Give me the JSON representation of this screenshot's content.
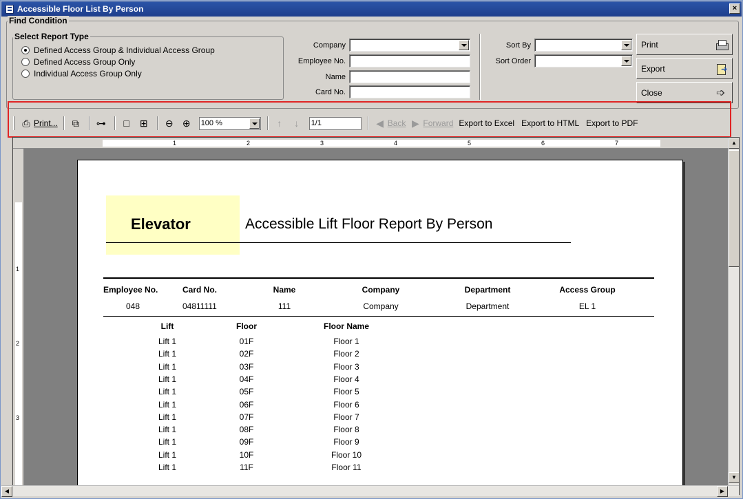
{
  "window": {
    "title": "Accessible Floor List By Person",
    "close_glyph": "×"
  },
  "find": {
    "legend": "Find Condition",
    "report_type_legend": "Select Report Type",
    "report_types": [
      {
        "label": "Defined Access Group & Individual Access Group",
        "checked": true
      },
      {
        "label": "Defined Access Group Only",
        "checked": false
      },
      {
        "label": "Individual Access Group Only",
        "checked": false
      }
    ],
    "company_label": "Company",
    "employee_no_label": "Employee No.",
    "name_label": "Name",
    "card_no_label": "Card No.",
    "sort_by_label": "Sort By",
    "sort_order_label": "Sort Order"
  },
  "side_buttons": {
    "print": "Print",
    "export": "Export",
    "close": "Close"
  },
  "toolbar": {
    "print_label": "Print...",
    "zoom": "100 %",
    "page": "1/1",
    "back": "Back",
    "forward": "Forward",
    "export_excel": "Export to Excel",
    "export_html": "Export to HTML",
    "export_pdf": "Export to PDF"
  },
  "ruler": {
    "h_ticks": [
      "1",
      "2",
      "3",
      "4",
      "5",
      "6",
      "7"
    ],
    "v_ticks": [
      "1",
      "2",
      "3"
    ]
  },
  "report": {
    "badge": "Elevator",
    "title": "Accessible Lift Floor Report By Person",
    "headers": [
      "Employee No.",
      "Card No.",
      "Name",
      "Company",
      "Department",
      "Access Group"
    ],
    "person": [
      "048",
      "04811111",
      "111",
      "Company",
      "Department",
      "EL 1"
    ],
    "sub_headers": [
      "Lift",
      "Floor",
      "Floor Name"
    ],
    "rows": [
      [
        "Lift 1",
        "01F",
        "Floor 1"
      ],
      [
        "Lift 1",
        "02F",
        "Floor 2"
      ],
      [
        "Lift 1",
        "03F",
        "Floor 3"
      ],
      [
        "Lift 1",
        "04F",
        "Floor 4"
      ],
      [
        "Lift 1",
        "05F",
        "Floor 5"
      ],
      [
        "Lift 1",
        "06F",
        "Floor 6"
      ],
      [
        "Lift 1",
        "07F",
        "Floor 7"
      ],
      [
        "Lift 1",
        "08F",
        "Floor 8"
      ],
      [
        "Lift 1",
        "09F",
        "Floor 9"
      ],
      [
        "Lift 1",
        "10F",
        "Floor 10"
      ],
      [
        "Lift 1",
        "11F",
        "Floor 11"
      ]
    ]
  },
  "colors": {
    "title_bar": "#1f3f8c",
    "highlight": "#e02424",
    "badge": "#ffffc4"
  }
}
